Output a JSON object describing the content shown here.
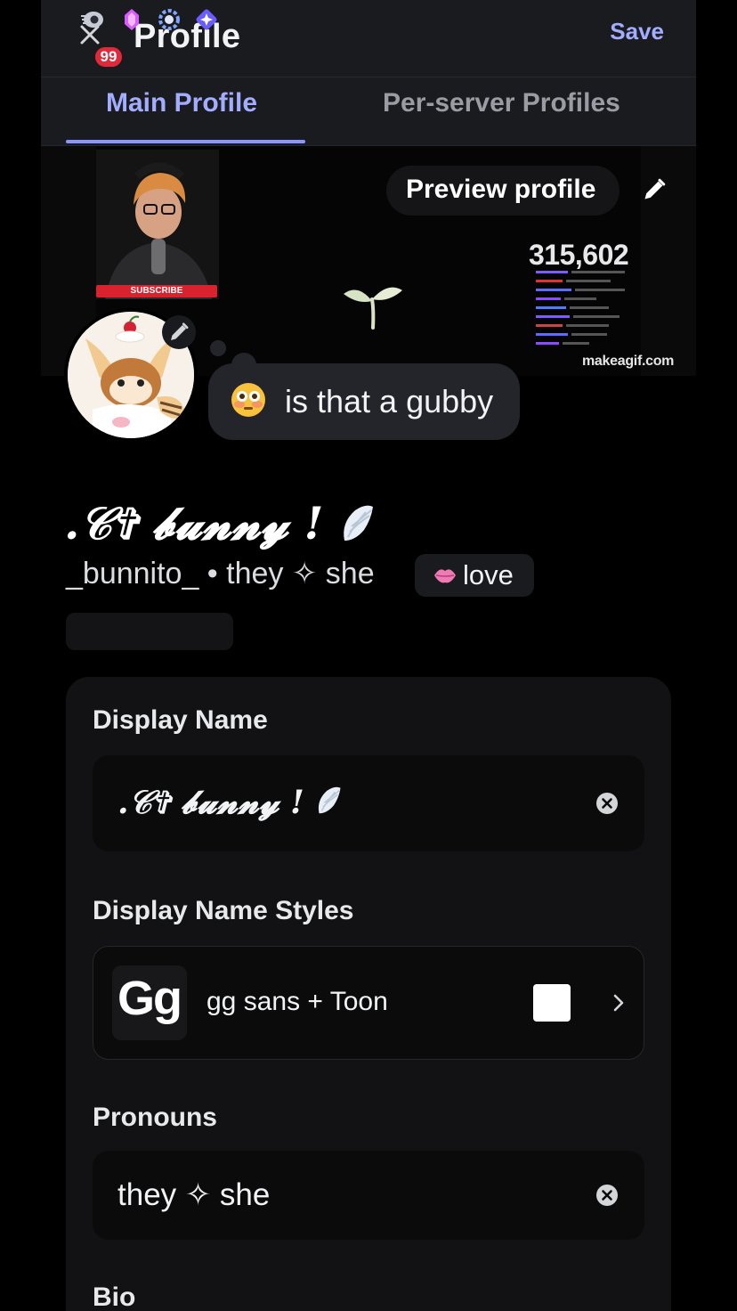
{
  "header": {
    "close_icon": "close-icon",
    "notification_count": "99",
    "title": "Profile",
    "save_label": "Save",
    "accent": "#a3adff"
  },
  "tabs": [
    {
      "label": "Main Profile",
      "active": true
    },
    {
      "label": "Per-server Profiles",
      "active": false
    }
  ],
  "banner": {
    "subscribe_label": "SUBSCRIBE",
    "counter": "315,602",
    "watermark": "makeagif.com",
    "preview_label": "Preview profile"
  },
  "status": {
    "emoji": "flushed-face",
    "text": "is that a gubby"
  },
  "profile": {
    "display_name": ".𝒞✞ 𝓫𝓾𝓷𝓷𝔂 !",
    "display_name_emoji": "wing",
    "user_line": "_bunnito_ • they ✧ she",
    "tag_label": "love",
    "tag_icon": "lips-icon",
    "badges": [
      "nitro-badge",
      "boost-gem-badge",
      "hypesquad-badge",
      "quest-badge"
    ]
  },
  "form": {
    "display_name_label": "Display Name",
    "display_name_value": ".𝒞✞ 𝓫𝓾𝓷𝓷𝔂 !",
    "styles_label": "Display Name Styles",
    "style_preview": "Gg",
    "style_value": "gg sans + Toon",
    "style_color": "#ffffff",
    "pronouns_label": "Pronouns",
    "pronouns_value": "they ✧ she",
    "bio_label": "Bio"
  }
}
